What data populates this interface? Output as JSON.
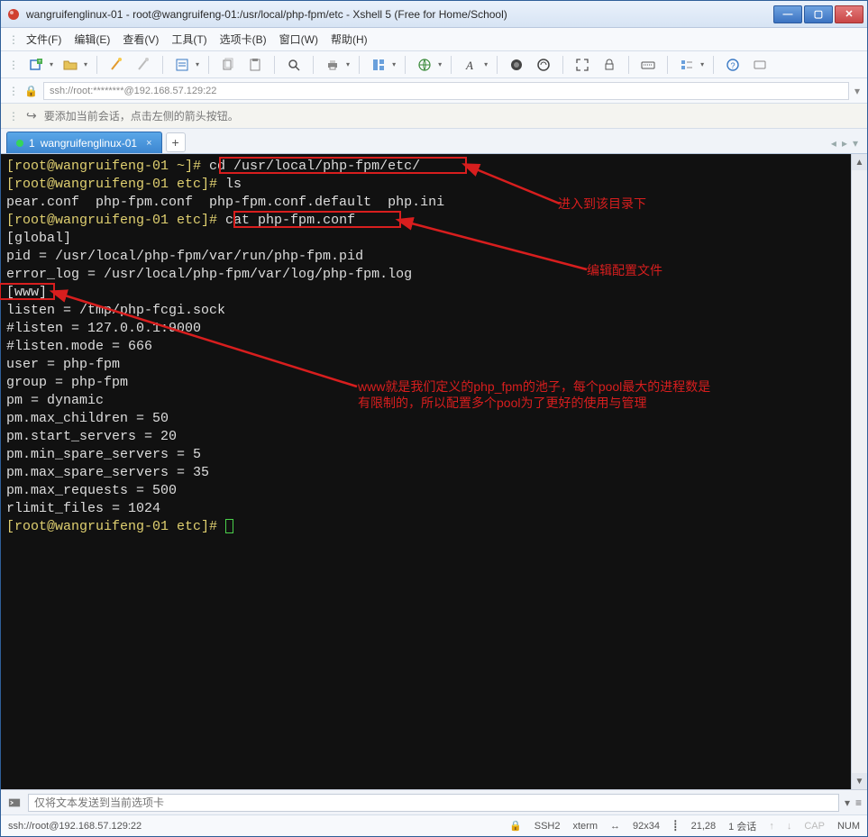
{
  "window": {
    "title": "wangruifenglinux-01 - root@wangruifeng-01:/usr/local/php-fpm/etc - Xshell 5 (Free for Home/School)"
  },
  "menu": {
    "file": "文件(F)",
    "edit": "编辑(E)",
    "view": "查看(V)",
    "tools": "工具(T)",
    "tabs": "选项卡(B)",
    "window": "窗口(W)",
    "help": "帮助(H)"
  },
  "address": "ssh://root:********@192.168.57.129:22",
  "hint": "要添加当前会话，点击左侧的箭头按钮。",
  "tab": {
    "index": "1",
    "name": "wangruifenglinux-01"
  },
  "term": {
    "l1_prompt": "[root@wangruifeng-01 ~]#",
    "l1_cmd": " cd /usr/local/php-fpm/etc/",
    "l2_prompt": "[root@wangruifeng-01 etc]#",
    "l2_cmd": " ls",
    "l3": "pear.conf  php-fpm.conf  php-fpm.conf.default  php.ini",
    "l4_prompt": "[root@wangruifeng-01 etc]#",
    "l4_cmd": " cat php-fpm.conf",
    "l5": "[global]",
    "l6": "pid = /usr/local/php-fpm/var/run/php-fpm.pid",
    "l7": "error_log = /usr/local/php-fpm/var/log/php-fpm.log",
    "l8": "[www]",
    "l9": "listen = /tmp/php-fcgi.sock",
    "l10": "#listen = 127.0.0.1:9000",
    "l11": "#listen.mode = 666",
    "l12": "user = php-fpm",
    "l13": "group = php-fpm",
    "l14": "pm = dynamic",
    "l15": "pm.max_children = 50",
    "l16": "pm.start_servers = 20",
    "l17": "pm.min_spare_servers = 5",
    "l18": "pm.max_spare_servers = 35",
    "l19": "pm.max_requests = 500",
    "l20": "rlimit_files = 1024",
    "l21_prompt": "[root@wangruifeng-01 etc]# "
  },
  "sendbar": {
    "placeholder": "仅将文本发送到当前选项卡"
  },
  "status": {
    "conn": "ssh://root@192.168.57.129:22",
    "ssh": "SSH2",
    "term": "xterm",
    "size": "92x34",
    "cursor": "21,28",
    "sessions": "1 会话",
    "cap": "CAP",
    "num": "NUM"
  },
  "annotations": {
    "a1": "进入到该目录下",
    "a2": "编辑配置文件",
    "a3": "www就是我们定义的php_fpm的池子，每个pool最大的进程数是\n有限制的，所以配置多个pool为了更好的使用与管理"
  },
  "icons": {
    "lock": "🔒",
    "arrow_hint": "⮡"
  }
}
